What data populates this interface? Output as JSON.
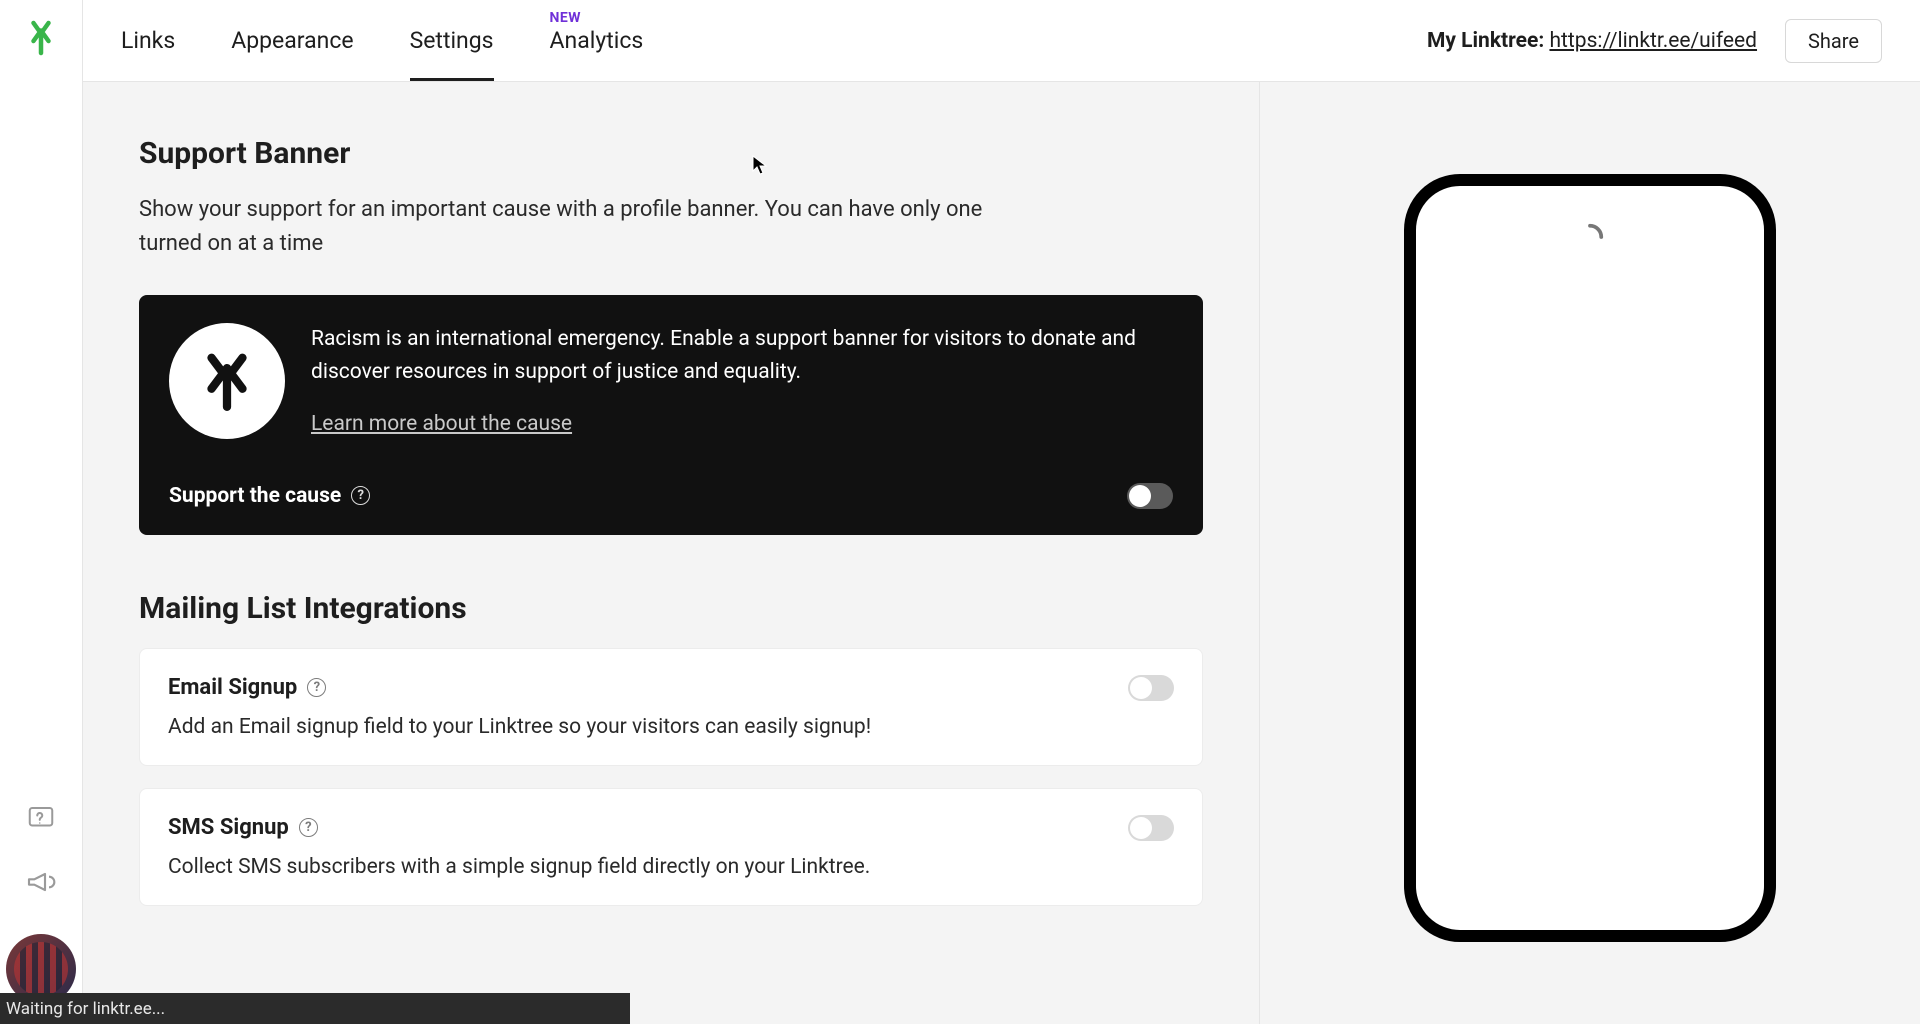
{
  "nav": {
    "tabs": [
      {
        "label": "Links",
        "active": false
      },
      {
        "label": "Appearance",
        "active": false
      },
      {
        "label": "Settings",
        "active": true
      },
      {
        "label": "Analytics",
        "active": false,
        "badge": "NEW"
      }
    ]
  },
  "header": {
    "mylinktree_label": "My Linktree:",
    "mylinktree_url": "https://linktr.ee/uifeed",
    "share_label": "Share"
  },
  "sections": {
    "support_banner": {
      "title": "Support Banner",
      "description": "Show your support for an important cause with a profile banner. You can have only one turned on at a time",
      "cause_text": "Racism is an international emergency. Enable a support banner for visitors to donate and discover resources in support of justice and equality.",
      "learn_more": "Learn more about the cause",
      "toggle_label": "Support the cause",
      "toggle_on": false
    },
    "mailing_list": {
      "title": "Mailing List Integrations",
      "items": [
        {
          "title": "Email Signup",
          "desc": "Add an Email signup field to your Linktree so your visitors can easily signup!",
          "on": false
        },
        {
          "title": "SMS Signup",
          "desc": "Collect SMS subscribers with a simple signup field directly on your Linktree.",
          "on": false
        }
      ]
    }
  },
  "status_bar": "Waiting for linktr.ee...",
  "help_glyph": "?"
}
